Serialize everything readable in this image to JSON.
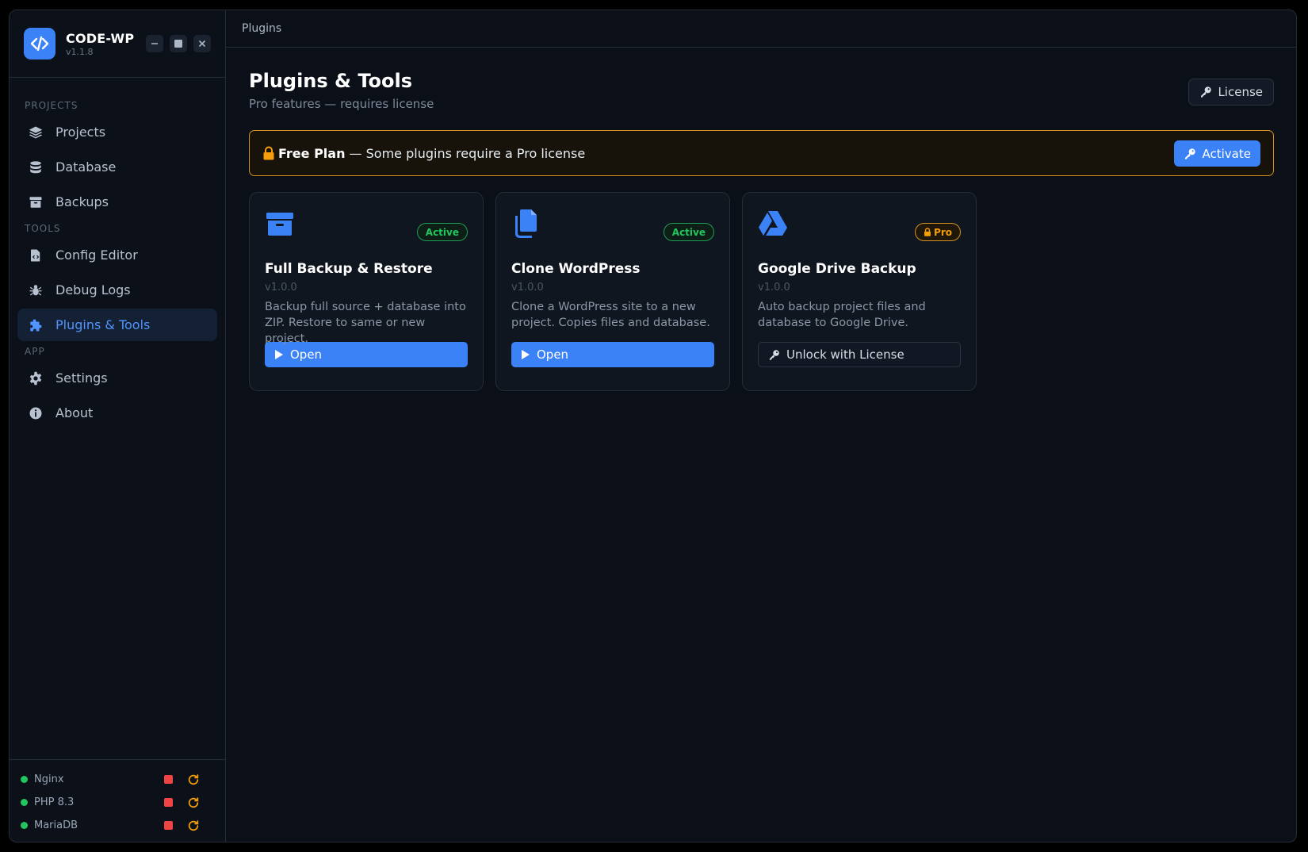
{
  "app": {
    "name": "CODE-WP",
    "version": "v1.1.8"
  },
  "sidebar": {
    "sections": [
      {
        "label": "PROJECTS",
        "items": [
          {
            "label": "Projects",
            "icon": "layers-icon"
          },
          {
            "label": "Database",
            "icon": "database-icon"
          },
          {
            "label": "Backups",
            "icon": "archive-icon"
          }
        ]
      },
      {
        "label": "TOOLS",
        "items": [
          {
            "label": "Config Editor",
            "icon": "file-code-icon"
          },
          {
            "label": "Debug Logs",
            "icon": "bug-icon"
          },
          {
            "label": "Plugins & Tools",
            "icon": "puzzle-icon",
            "active": true
          }
        ]
      },
      {
        "label": "APP",
        "items": [
          {
            "label": "Settings",
            "icon": "gear-icon"
          },
          {
            "label": "About",
            "icon": "info-icon"
          }
        ]
      }
    ],
    "services": [
      {
        "label": "Nginx",
        "status": "running"
      },
      {
        "label": "PHP 8.3",
        "status": "running"
      },
      {
        "label": "MariaDB",
        "status": "running"
      }
    ]
  },
  "breadcrumb": "Plugins",
  "page": {
    "title": "Plugins & Tools",
    "subtitle": "Pro features — requires license",
    "license_label": "License"
  },
  "banner": {
    "plan": "Free Plan",
    "message": " — Some plugins require a Pro license",
    "activate_label": "Activate"
  },
  "plugins": [
    {
      "title": "Full Backup & Restore",
      "version": "v1.0.0",
      "description": "Backup full source + database into ZIP. Restore to same or new project.",
      "badge": "Active",
      "action": "Open",
      "icon": "archive-box-icon"
    },
    {
      "title": "Clone WordPress",
      "version": "v1.0.0",
      "description": "Clone a WordPress site to a new project. Copies files and database.",
      "badge": "Active",
      "action": "Open",
      "icon": "copy-icon"
    },
    {
      "title": "Google Drive Backup",
      "version": "v1.0.0",
      "description": "Auto backup project files and database to Google Drive.",
      "badge": "Pro",
      "action": "Unlock with License",
      "icon": "google-drive-icon"
    }
  ],
  "colors": {
    "accent": "#3b82f6",
    "active_green": "#22c55e",
    "warning_amber": "#f59e0b",
    "stop_red": "#ef4444",
    "background": "#0b1018"
  }
}
